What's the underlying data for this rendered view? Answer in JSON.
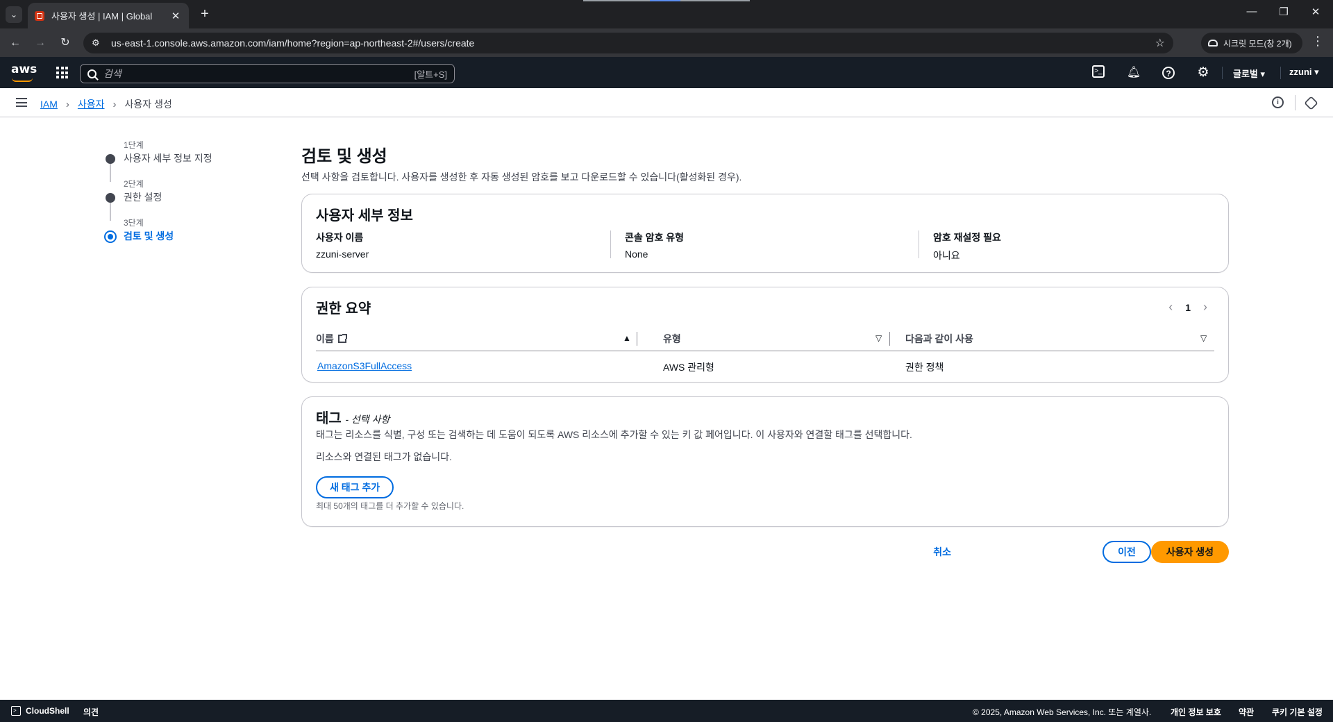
{
  "browser": {
    "tab_title": "사용자 생성 | IAM | Global",
    "url": "us-east-1.console.aws.amazon.com/iam/home?region=ap-northeast-2#/users/create",
    "incognito_label": "시크릿 모드(창 2개)"
  },
  "topnav": {
    "logo_text": "aws",
    "search_placeholder": "검색",
    "search_shortcut": "[알트+S]",
    "region": "글로벌 ▾",
    "account": "zzuni ▾"
  },
  "breadcrumb": {
    "items": [
      "IAM",
      "사용자"
    ],
    "current": "사용자 생성"
  },
  "steps": [
    {
      "num": "1단계",
      "label": "사용자 세부 정보 지정",
      "active": false
    },
    {
      "num": "2단계",
      "label": "권한 설정",
      "active": false
    },
    {
      "num": "3단계",
      "label": "검토 및 생성",
      "active": true
    }
  ],
  "page": {
    "title": "검토 및 생성",
    "description": "선택 사항을 검토합니다. 사용자를 생성한 후 자동 생성된 암호를 보고 다운로드할 수 있습니다(활성화된 경우)."
  },
  "user_details": {
    "title": "사용자 세부 정보",
    "fields": [
      {
        "key": "사용자 이름",
        "value": "zzuni-server"
      },
      {
        "key": "콘솔 암호 유형",
        "value": "None"
      },
      {
        "key": "암호 재설정 필요",
        "value": "아니요"
      }
    ]
  },
  "permissions": {
    "title": "권한 요약",
    "page": "1",
    "columns": [
      "이름",
      "유형",
      "다음과 같이 사용"
    ],
    "rows": [
      {
        "name": "AmazonS3FullAccess",
        "type": "AWS 관리형",
        "used_as": "권한 정책"
      }
    ]
  },
  "tags": {
    "title": "태그",
    "optional": "- 선택 사항",
    "description": "태그는 리소스를 식별, 구성 또는 검색하는 데 도움이 되도록 AWS 리소스에 추가할 수 있는 키 값 페어입니다. 이 사용자와 연결할 태그를 선택합니다.",
    "empty": "리소스와 연결된 태그가 없습니다.",
    "add_button": "새 태그 추가",
    "hint": "최대 50개의 태그를 더 추가할 수 있습니다."
  },
  "actions": {
    "cancel": "취소",
    "previous": "이전",
    "create": "사용자 생성"
  },
  "footer": {
    "cloudshell": "CloudShell",
    "feedback": "의견",
    "copyright": "© 2025, Amazon Web Services, Inc. 또는 계열사.",
    "privacy": "개인 정보 보호",
    "terms": "약관",
    "cookies": "쿠키 기본 설정"
  },
  "colors": {
    "link": "#006ce0",
    "primary": "#ff9900",
    "nav_bg": "#161d26"
  }
}
